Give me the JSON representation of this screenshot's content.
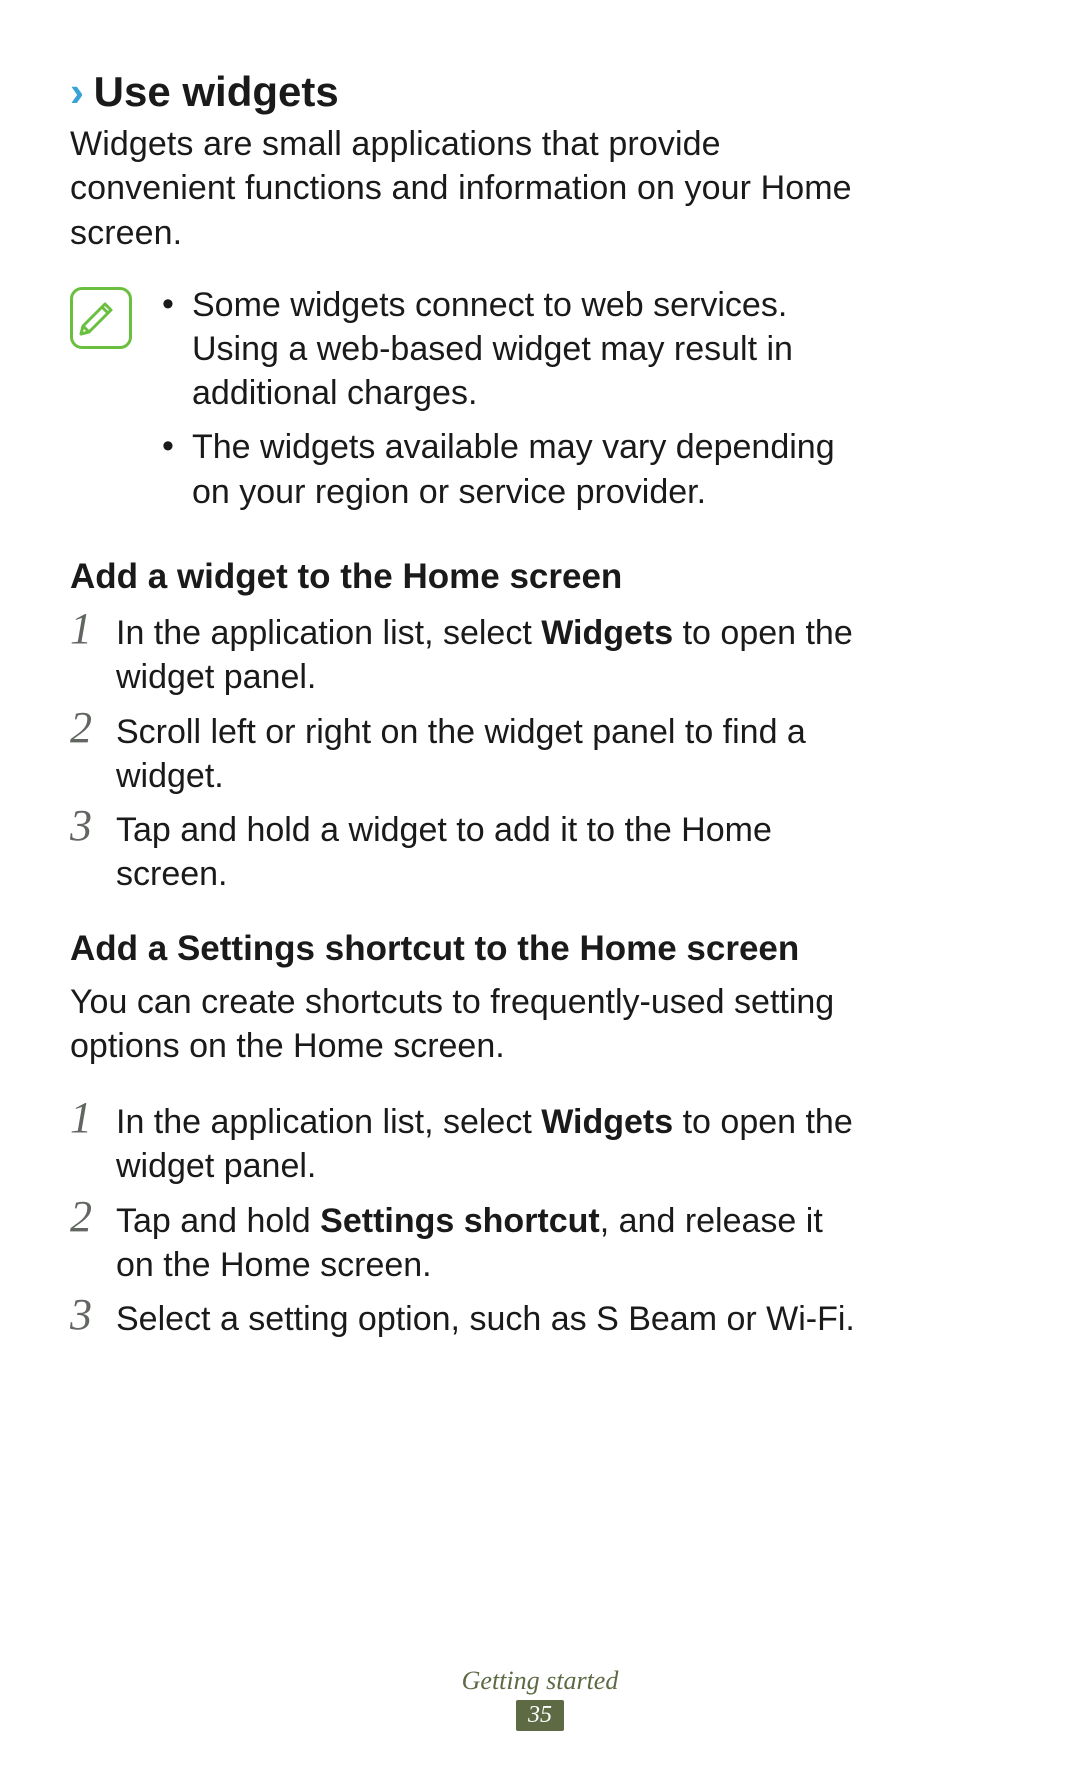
{
  "heading": {
    "chevron": "›",
    "title": "Use widgets"
  },
  "intro": "Widgets are small applications that provide convenient functions and information on your Home screen.",
  "notes": [
    "Some widgets connect to web services. Using a web-based widget may result in additional charges.",
    "The widgets available may vary depending on your region or service provider."
  ],
  "section1": {
    "title": "Add a widget to the Home screen",
    "steps": [
      {
        "n": "1",
        "pre": "In the application list, select ",
        "bold": "Widgets",
        "post": " to open the widget panel."
      },
      {
        "n": "2",
        "pre": "Scroll left or right on the widget panel to find a widget.",
        "bold": "",
        "post": ""
      },
      {
        "n": "3",
        "pre": "Tap and hold a widget to add it to the Home screen.",
        "bold": "",
        "post": ""
      }
    ]
  },
  "section2": {
    "title": "Add a Settings shortcut to the Home screen",
    "intro": "You can create shortcuts to frequently-used setting options on the Home screen.",
    "steps": [
      {
        "n": "1",
        "pre": "In the application list, select ",
        "bold": "Widgets",
        "post": " to open the widget panel."
      },
      {
        "n": "2",
        "pre": "Tap and hold ",
        "bold": "Settings shortcut",
        "post": ", and release it on the Home screen."
      },
      {
        "n": "3",
        "pre": "Select a setting option, such as S Beam or Wi-Fi.",
        "bold": "",
        "post": ""
      }
    ]
  },
  "footer": {
    "section": "Getting started",
    "page": "35"
  }
}
